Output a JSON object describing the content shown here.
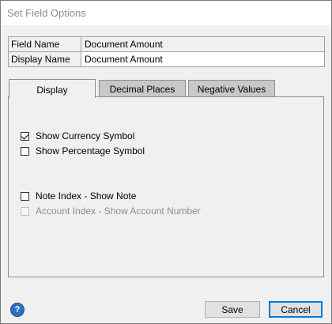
{
  "window": {
    "title": "Set Field Options"
  },
  "fields": [
    {
      "label": "Field Name",
      "value": "Document Amount"
    },
    {
      "label": "Display Name",
      "value": "Document Amount"
    }
  ],
  "tabs": [
    {
      "label": "Display",
      "active": true
    },
    {
      "label": "Decimal Places",
      "active": false
    },
    {
      "label": "Negative Values",
      "active": false
    }
  ],
  "display_options": [
    {
      "label": "Show Currency Symbol",
      "checked": true,
      "enabled": true
    },
    {
      "label": "Show Percentage Symbol",
      "checked": false,
      "enabled": true
    },
    {
      "label": "Note Index - Show Note",
      "checked": false,
      "enabled": true
    },
    {
      "label": "Account Index - Show Account Number",
      "checked": false,
      "enabled": false
    }
  ],
  "footer": {
    "help_icon": "question-mark-icon",
    "save_label": "Save",
    "cancel_label": "Cancel"
  }
}
